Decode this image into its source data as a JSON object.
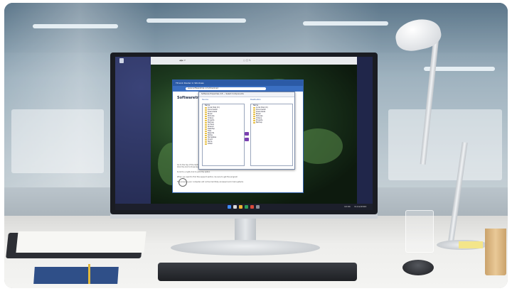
{
  "browser": {
    "tab_title": "TP-Link Router in Windows",
    "address": "www.softwaretrial.com/download",
    "brand": "Softwaretrial",
    "nav_items": [
      "Products",
      "Solutions",
      "Pricing",
      "Resources",
      "Free Trial"
    ],
    "lang": "English"
  },
  "dialog": {
    "title": "Software Properties 2.8 — Select Components",
    "left_header": "Source",
    "right_header": "Destination",
    "left_items": [
      "Name",
      "Local Disk (C:)",
      "Documents",
      "Downloads",
      "Music",
      "Pictures",
      "Videos",
      "Projects",
      "Backup",
      "Archive",
      "Shared",
      "Desktop",
      "Files",
      "Reports",
      "Notes",
      "Templates",
      "Cloud",
      "Temp",
      "Other"
    ],
    "right_items": [
      "Name",
      "Local Disk (C:)",
      "Documents",
      "Downloads",
      "Music",
      "Pictures",
      "Videos",
      "Projects",
      "Backup"
    ]
  },
  "page_text": {
    "step1": "Go to the top of the Options menu",
    "step2": "Click the link to Download to install",
    "step3": "Scroll to a right-click to pick the option",
    "step4": "When you want to find the support section, be sure to get the program",
    "step5": "This ensures your computer will not be harmfully accessed and most systems"
  },
  "taskbar": {
    "time": "10:04",
    "date": "11/12/2024"
  },
  "colors": {
    "accent": "#2b5aa6",
    "folder": "#e8c24a",
    "arrow": "#7b3fb0"
  }
}
